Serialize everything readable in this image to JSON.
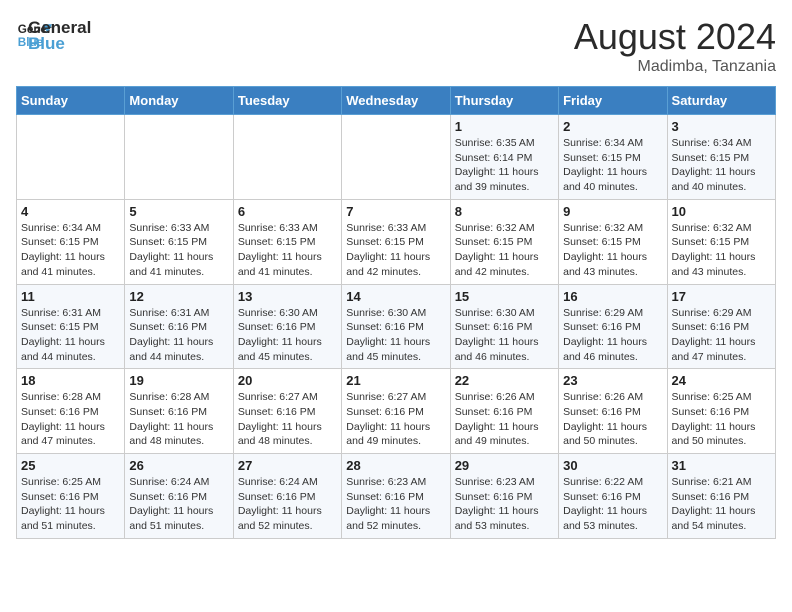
{
  "header": {
    "logo_line1": "General",
    "logo_line2": "Blue",
    "month_year": "August 2024",
    "location": "Madimba, Tanzania"
  },
  "days_of_week": [
    "Sunday",
    "Monday",
    "Tuesday",
    "Wednesday",
    "Thursday",
    "Friday",
    "Saturday"
  ],
  "weeks": [
    [
      {
        "day": "",
        "info": ""
      },
      {
        "day": "",
        "info": ""
      },
      {
        "day": "",
        "info": ""
      },
      {
        "day": "",
        "info": ""
      },
      {
        "day": "1",
        "info": "Sunrise: 6:35 AM\nSunset: 6:14 PM\nDaylight: 11 hours and 39 minutes."
      },
      {
        "day": "2",
        "info": "Sunrise: 6:34 AM\nSunset: 6:15 PM\nDaylight: 11 hours and 40 minutes."
      },
      {
        "day": "3",
        "info": "Sunrise: 6:34 AM\nSunset: 6:15 PM\nDaylight: 11 hours and 40 minutes."
      }
    ],
    [
      {
        "day": "4",
        "info": "Sunrise: 6:34 AM\nSunset: 6:15 PM\nDaylight: 11 hours and 41 minutes."
      },
      {
        "day": "5",
        "info": "Sunrise: 6:33 AM\nSunset: 6:15 PM\nDaylight: 11 hours and 41 minutes."
      },
      {
        "day": "6",
        "info": "Sunrise: 6:33 AM\nSunset: 6:15 PM\nDaylight: 11 hours and 41 minutes."
      },
      {
        "day": "7",
        "info": "Sunrise: 6:33 AM\nSunset: 6:15 PM\nDaylight: 11 hours and 42 minutes."
      },
      {
        "day": "8",
        "info": "Sunrise: 6:32 AM\nSunset: 6:15 PM\nDaylight: 11 hours and 42 minutes."
      },
      {
        "day": "9",
        "info": "Sunrise: 6:32 AM\nSunset: 6:15 PM\nDaylight: 11 hours and 43 minutes."
      },
      {
        "day": "10",
        "info": "Sunrise: 6:32 AM\nSunset: 6:15 PM\nDaylight: 11 hours and 43 minutes."
      }
    ],
    [
      {
        "day": "11",
        "info": "Sunrise: 6:31 AM\nSunset: 6:15 PM\nDaylight: 11 hours and 44 minutes."
      },
      {
        "day": "12",
        "info": "Sunrise: 6:31 AM\nSunset: 6:16 PM\nDaylight: 11 hours and 44 minutes."
      },
      {
        "day": "13",
        "info": "Sunrise: 6:30 AM\nSunset: 6:16 PM\nDaylight: 11 hours and 45 minutes."
      },
      {
        "day": "14",
        "info": "Sunrise: 6:30 AM\nSunset: 6:16 PM\nDaylight: 11 hours and 45 minutes."
      },
      {
        "day": "15",
        "info": "Sunrise: 6:30 AM\nSunset: 6:16 PM\nDaylight: 11 hours and 46 minutes."
      },
      {
        "day": "16",
        "info": "Sunrise: 6:29 AM\nSunset: 6:16 PM\nDaylight: 11 hours and 46 minutes."
      },
      {
        "day": "17",
        "info": "Sunrise: 6:29 AM\nSunset: 6:16 PM\nDaylight: 11 hours and 47 minutes."
      }
    ],
    [
      {
        "day": "18",
        "info": "Sunrise: 6:28 AM\nSunset: 6:16 PM\nDaylight: 11 hours and 47 minutes."
      },
      {
        "day": "19",
        "info": "Sunrise: 6:28 AM\nSunset: 6:16 PM\nDaylight: 11 hours and 48 minutes."
      },
      {
        "day": "20",
        "info": "Sunrise: 6:27 AM\nSunset: 6:16 PM\nDaylight: 11 hours and 48 minutes."
      },
      {
        "day": "21",
        "info": "Sunrise: 6:27 AM\nSunset: 6:16 PM\nDaylight: 11 hours and 49 minutes."
      },
      {
        "day": "22",
        "info": "Sunrise: 6:26 AM\nSunset: 6:16 PM\nDaylight: 11 hours and 49 minutes."
      },
      {
        "day": "23",
        "info": "Sunrise: 6:26 AM\nSunset: 6:16 PM\nDaylight: 11 hours and 50 minutes."
      },
      {
        "day": "24",
        "info": "Sunrise: 6:25 AM\nSunset: 6:16 PM\nDaylight: 11 hours and 50 minutes."
      }
    ],
    [
      {
        "day": "25",
        "info": "Sunrise: 6:25 AM\nSunset: 6:16 PM\nDaylight: 11 hours and 51 minutes."
      },
      {
        "day": "26",
        "info": "Sunrise: 6:24 AM\nSunset: 6:16 PM\nDaylight: 11 hours and 51 minutes."
      },
      {
        "day": "27",
        "info": "Sunrise: 6:24 AM\nSunset: 6:16 PM\nDaylight: 11 hours and 52 minutes."
      },
      {
        "day": "28",
        "info": "Sunrise: 6:23 AM\nSunset: 6:16 PM\nDaylight: 11 hours and 52 minutes."
      },
      {
        "day": "29",
        "info": "Sunrise: 6:23 AM\nSunset: 6:16 PM\nDaylight: 11 hours and 53 minutes."
      },
      {
        "day": "30",
        "info": "Sunrise: 6:22 AM\nSunset: 6:16 PM\nDaylight: 11 hours and 53 minutes."
      },
      {
        "day": "31",
        "info": "Sunrise: 6:21 AM\nSunset: 6:16 PM\nDaylight: 11 hours and 54 minutes."
      }
    ]
  ]
}
